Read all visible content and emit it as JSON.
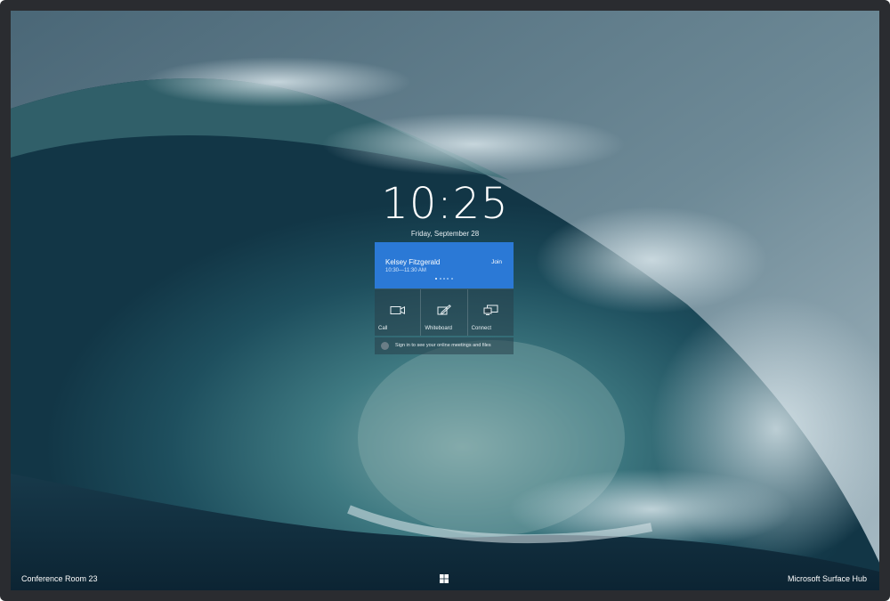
{
  "lockscreen": {
    "time": "10:25",
    "date": "Friday, September 28"
  },
  "meeting_card": {
    "organizer": "Kelsey Fitzgerald",
    "time_range": "10:30—11:30 AM",
    "join_label": "Join",
    "page_count": 5,
    "active_page": 1,
    "accent_color": "#2b79d6"
  },
  "actions": [
    {
      "label": "Call",
      "icon": "video-camera-icon"
    },
    {
      "label": "Whiteboard",
      "icon": "pen-whiteboard-icon"
    },
    {
      "label": "Connect",
      "icon": "screen-cast-icon"
    }
  ],
  "signin": {
    "text": "Sign in to see your online meetings and files",
    "icon": "person-icon"
  },
  "taskbar": {
    "room_name": "Conference Room 23",
    "device_name": "Microsoft Surface Hub",
    "start_icon": "windows-logo-icon"
  }
}
